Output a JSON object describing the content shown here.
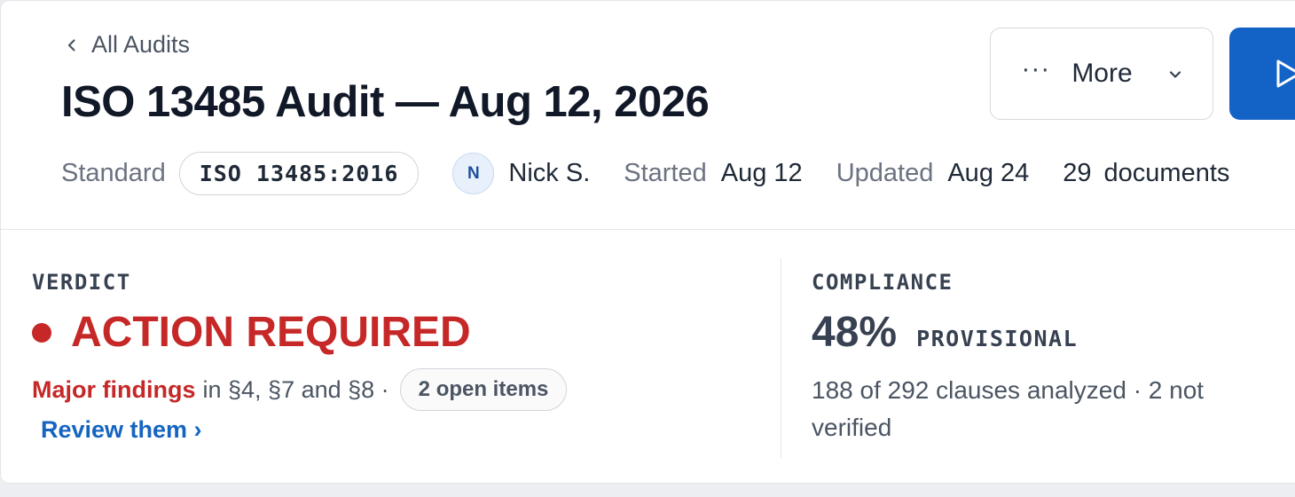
{
  "header": {
    "back_label": "All Audits",
    "title": "ISO 13485 Audit — Aug 12, 2026",
    "more_button": {
      "dots": "···",
      "label": "More"
    },
    "primary_button_icon": "play-icon"
  },
  "meta": {
    "standard_label": "Standard",
    "standard_value": "ISO 13485:2016",
    "owner_initial": "N",
    "owner_name": "Nick S.",
    "started_label": "Started",
    "started_value": "Aug 12",
    "updated_label": "Updated",
    "updated_value": "Aug 24",
    "documents_count": "29",
    "documents_label": "documents"
  },
  "verdict": {
    "label": "VERDICT",
    "value": "ACTION REQUIRED",
    "findings_strong": "Major findings",
    "findings_rest": "in §4, §7 and §8 ·",
    "open_items": "2 open items",
    "review_link": "Review them ›"
  },
  "compliance": {
    "label": "COMPLIANCE",
    "percent": "48%",
    "status": "PROVISIONAL",
    "detail": "188 of 292 clauses analyzed · 2 not verified"
  },
  "colors": {
    "accent": "#1363c6",
    "danger": "#c62828",
    "link": "#1565c0"
  }
}
